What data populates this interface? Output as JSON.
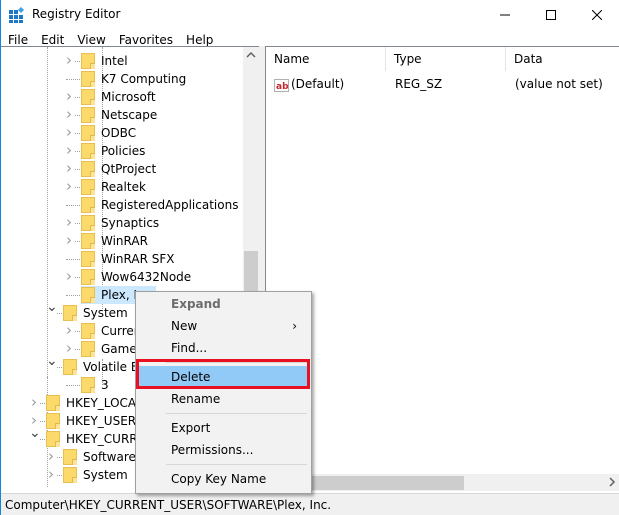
{
  "window": {
    "title": "Registry Editor",
    "icons": {
      "app": "registry-editor-icon",
      "minimize": "minimize-icon",
      "maximize": "maximize-icon",
      "close": "close-icon"
    }
  },
  "menubar": [
    "File",
    "Edit",
    "View",
    "Favorites",
    "Help"
  ],
  "tree": {
    "items": [
      {
        "label": "Intel",
        "expander": "collapsed"
      },
      {
        "label": "K7 Computing",
        "expander": "none"
      },
      {
        "label": "Microsoft",
        "expander": "collapsed"
      },
      {
        "label": "Netscape",
        "expander": "collapsed"
      },
      {
        "label": "ODBC",
        "expander": "collapsed"
      },
      {
        "label": "Policies",
        "expander": "collapsed"
      },
      {
        "label": "QtProject",
        "expander": "collapsed"
      },
      {
        "label": "Realtek",
        "expander": "collapsed"
      },
      {
        "label": "RegisteredApplications",
        "expander": "none"
      },
      {
        "label": "Synaptics",
        "expander": "collapsed"
      },
      {
        "label": "WinRAR",
        "expander": "collapsed"
      },
      {
        "label": "WinRAR SFX",
        "expander": "none"
      },
      {
        "label": "Wow6432Node",
        "expander": "collapsed"
      },
      {
        "label": "Plex, I",
        "expander": "none",
        "selected": true
      },
      {
        "label": "System",
        "expander": "expanded"
      },
      {
        "label": "Curren",
        "expander": "collapsed"
      },
      {
        "label": "Game",
        "expander": "collapsed"
      },
      {
        "label": "Volatile En",
        "expander": "expanded"
      },
      {
        "label": "3",
        "expander": "none"
      },
      {
        "label": "HKEY_LOCAL",
        "expander": "collapsed"
      },
      {
        "label": "HKEY_USERS",
        "expander": "collapsed"
      },
      {
        "label": "HKEY_CURRE",
        "expander": "expanded"
      },
      {
        "label": "Software",
        "expander": "collapsed"
      },
      {
        "label": "System",
        "expander": "collapsed"
      }
    ]
  },
  "list": {
    "columns": [
      "Name",
      "Type",
      "Data"
    ],
    "rows": [
      {
        "name": "(Default)",
        "type": "REG_SZ",
        "data": "(value not set)",
        "icon": "string-value-icon"
      }
    ]
  },
  "context_menu": {
    "items": [
      {
        "label": "Expand",
        "disabled": true
      },
      {
        "label": "New",
        "submenu": true
      },
      {
        "label": "Find..."
      },
      {
        "label": "Delete",
        "highlighted": true
      },
      {
        "label": "Rename"
      },
      {
        "label": "Export"
      },
      {
        "label": "Permissions..."
      },
      {
        "label": "Copy Key Name"
      }
    ],
    "submenu_arrow": "›"
  },
  "status_bar": {
    "path": "Computer\\HKEY_CURRENT_USER\\SOFTWARE\\Plex, Inc."
  },
  "colors": {
    "highlight": "#91c9f7",
    "selection": "#cce8ff",
    "callout": "#e81123",
    "folder": "#fcd96b"
  }
}
